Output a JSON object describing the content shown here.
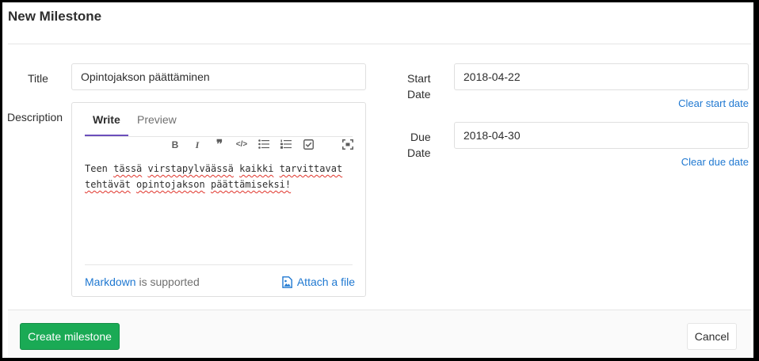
{
  "page": {
    "title": "New Milestone"
  },
  "form": {
    "title_label": "Title",
    "title_value": "Opintojakson päättäminen",
    "description_label": "Description",
    "start_date_label_1": "Start",
    "start_date_label_2": "Date",
    "start_date_value": "2018-04-22",
    "clear_start_date": "Clear start date",
    "due_date_label_1": "Due",
    "due_date_label_2": "Date",
    "due_date_value": "2018-04-30",
    "clear_due_date": "Clear due date"
  },
  "editor": {
    "tabs": [
      {
        "label": "Write",
        "active": true
      },
      {
        "label": "Preview",
        "active": false
      }
    ],
    "toolbar": [
      "bold-icon",
      "italic-icon",
      "quote-icon",
      "code-icon",
      "bullet-list-icon",
      "numbered-list-icon",
      "task-list-icon",
      "fullscreen-icon"
    ],
    "text": {
      "w1": "Teen",
      "w2": "tässä",
      "w3": "virstapylväässä",
      "w4": "kaikki",
      "w5": "tarvittavat",
      "w6": "tehtävät",
      "w7": "opintojakson",
      "w8": "päättämiseksi!"
    },
    "markdown_link": "Markdown",
    "markdown_suffix": "is supported",
    "attach_label": "Attach a file"
  },
  "footer": {
    "create_label": "Create milestone",
    "cancel_label": "Cancel"
  },
  "colors": {
    "primary_button": "#1aaa55",
    "link": "#1f78d1",
    "active_tab_underline": "#6b4fbb"
  }
}
